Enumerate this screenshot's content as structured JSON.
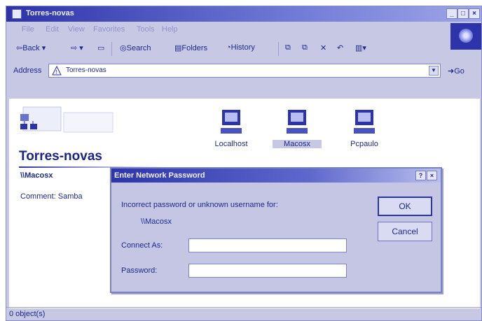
{
  "window": {
    "title": "Torres-novas"
  },
  "menu": [
    "File",
    "Edit",
    "View",
    "Favorites",
    "Tools",
    "Help"
  ],
  "toolbar": {
    "back": "Back",
    "search": "Search",
    "folders": "Folders",
    "history": "History"
  },
  "address": {
    "label": "Address",
    "value": "Torres-novas",
    "go": "Go"
  },
  "folder": {
    "heading": "Torres-novas",
    "selected": "\\\\Macosx",
    "comment": "Comment: Samba"
  },
  "computers": [
    {
      "label": "Localhost"
    },
    {
      "label": "Macosx"
    },
    {
      "label": "Pcpaulo"
    }
  ],
  "status": {
    "text": "0 object(s)"
  },
  "dialog": {
    "title": "Enter Network Password",
    "message": "Incorrect password or unknown username for:",
    "host": "\\\\Macosx",
    "connect_as_label": "Connect As:",
    "password_label": "Password:",
    "ok": "OK",
    "cancel": "Cancel"
  },
  "colors": {
    "accent": "#2d33a8",
    "text": "#1d2a8a",
    "chrome": "#c6c8e4"
  }
}
